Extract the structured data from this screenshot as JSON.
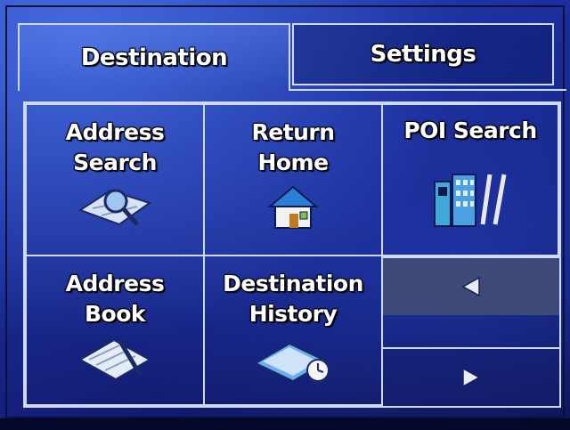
{
  "tabs": {
    "destination": "Destination",
    "settings": "Settings"
  },
  "menu": {
    "address_search": [
      "Address",
      "Search"
    ],
    "return_home": [
      "Return",
      "Home"
    ],
    "poi_search": [
      "POI Search"
    ],
    "address_book": [
      "Address",
      "Book"
    ],
    "destination_history": [
      "Destination",
      "History"
    ]
  },
  "icons": {
    "address_search": "magnifier-map-icon",
    "return_home": "house-icon",
    "poi_search": "poi-services-icon",
    "address_book": "notebook-pen-icon",
    "destination_history": "clipboard-clock-icon",
    "prev": "arrow-left-icon",
    "next": "arrow-right-icon"
  },
  "colors": {
    "background": "#1b2d9a",
    "border": "#cfd8ff",
    "selected_nav": "#3d4a78",
    "text": "#ffffff"
  }
}
